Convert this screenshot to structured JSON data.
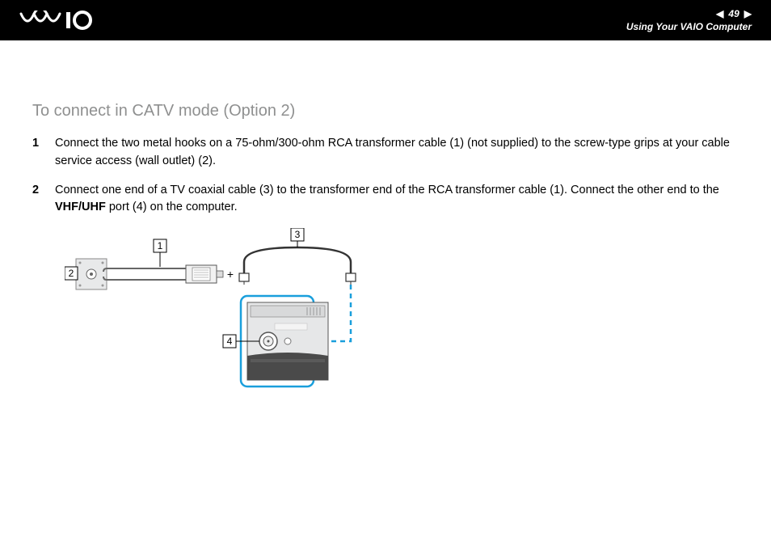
{
  "header": {
    "pageNumber": "49",
    "sectionTitle": "Using Your VAIO Computer",
    "prevArrow": "◀",
    "nextArrow": "▶"
  },
  "heading": "To connect in CATV mode (Option 2)",
  "steps": [
    {
      "num": "1",
      "text": "Connect the two metal hooks on a 75-ohm/300-ohm RCA transformer cable (1) (not supplied) to the screw-type grips at your cable service access (wall outlet) (2)."
    },
    {
      "num": "2",
      "textBeforeBold": "Connect one end of a TV coaxial cable (3) to the transformer end of the RCA transformer cable (1). Connect the other end to the ",
      "bold": "VHF/UHF",
      "textAfterBold": " port (4) on the computer."
    }
  ],
  "labels": {
    "l1": "1",
    "l2": "2",
    "l3": "3",
    "l4": "4"
  }
}
